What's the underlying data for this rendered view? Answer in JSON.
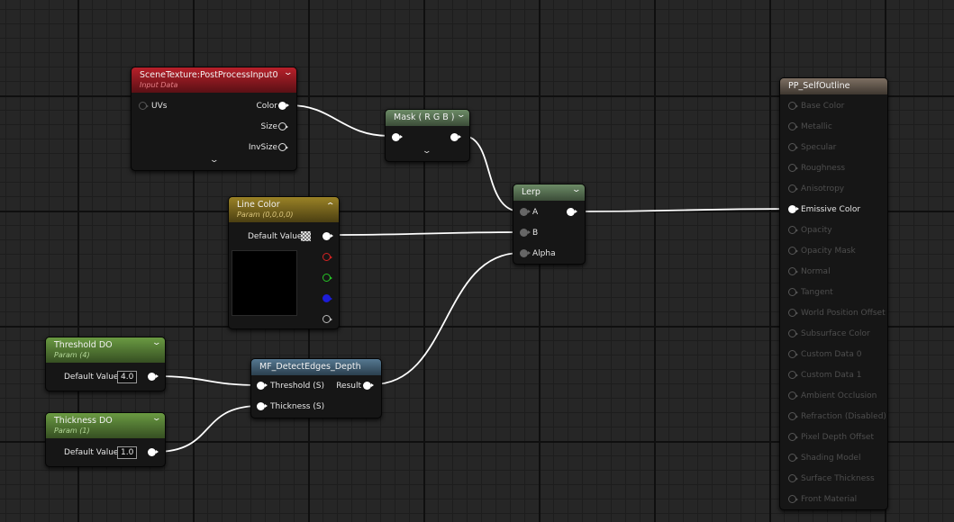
{
  "scene_texture": {
    "title": "SceneTexture:PostProcessInput0",
    "subtitle": "Input Data",
    "pins": {
      "uvs": "UVs",
      "color": "Color",
      "size": "Size",
      "invsize": "InvSize"
    }
  },
  "mask": {
    "title": "Mask ( R G B )"
  },
  "line_color": {
    "title": "Line Color",
    "subtitle": "Param (0,0,0,0)",
    "default_label": "Default Value"
  },
  "lerp": {
    "title": "Lerp",
    "pins": {
      "a": "A",
      "b": "B",
      "alpha": "Alpha"
    }
  },
  "threshold": {
    "title": "Threshold DO",
    "subtitle": "Param (4)",
    "default_label": "Default Value",
    "value": "4.0"
  },
  "thickness": {
    "title": "Thickness DO",
    "subtitle": "Param (1)",
    "default_label": "Default Value",
    "value": "1.0"
  },
  "detect_edges": {
    "title": "MF_DetectEdges_Depth",
    "inputs": {
      "threshold": "Threshold (S)",
      "thickness": "Thickness (S)"
    },
    "output": "Result"
  },
  "material": {
    "title": "PP_SelfOutline",
    "pins": [
      "Base Color",
      "Metallic",
      "Specular",
      "Roughness",
      "Anisotropy",
      "Emissive Color",
      "Opacity",
      "Opacity Mask",
      "Normal",
      "Tangent",
      "World Position Offset",
      "Subsurface Color",
      "Custom Data 0",
      "Custom Data 1",
      "Ambient Occlusion",
      "Refraction (Disabled)",
      "Pixel Depth Offset",
      "Shading Model",
      "Surface Thickness",
      "Front Material"
    ],
    "active_pin": "Emissive Color"
  },
  "colors": {
    "grid_bg": "#262626",
    "wire": "#ffffff",
    "texture_header": "#b8202a",
    "param_vector_header": "#9a8226",
    "param_scalar_header": "#6a9a42",
    "function_header": "#557891",
    "result_header": "#7d6f62"
  },
  "icons": {
    "collapse": "chevron-down-icon",
    "expand": "chevron-up-icon",
    "checker": "checker-swatch-icon"
  }
}
